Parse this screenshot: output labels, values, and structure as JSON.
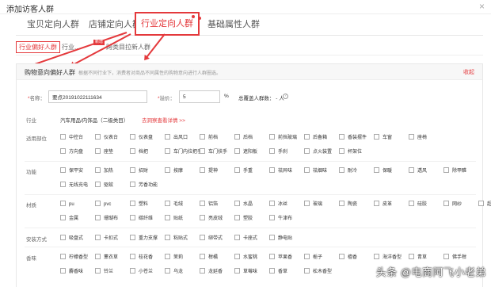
{
  "dialog": {
    "title": "添加访客人群"
  },
  "tabs": [
    {
      "label": "宝贝定向人群"
    },
    {
      "label": "店铺定向人群"
    },
    {
      "label": "行业定向人群"
    },
    {
      "label": "基础属性人群"
    }
  ],
  "subtabs": [
    {
      "label": "行业偏好人群"
    },
    {
      "label": "行业..."
    },
    {
      "label": "跨类目拉新人群"
    }
  ],
  "panel": {
    "title": "购物意向偏好人群",
    "hint": "根据不同行业下，消费者对商品不同属性的购物意向进行人群圈选。",
    "collapse": "收起"
  },
  "form": {
    "name_label": "名称：",
    "name_value": "要点20191022111634",
    "markup_label": "溢价：",
    "markup_value": "5",
    "markup_unit": "%",
    "audience_label": "总覆盖人群数： - 人",
    "industry_label": "行业",
    "industry_value": "汽车用品/内饰品（二级类目）",
    "industry_link": "去洞察查看详情 >>"
  },
  "groups": [
    {
      "label": "适用部位",
      "rows": [
        [
          "中控台",
          "仪表台",
          "仪表盘",
          "出风口",
          "前档",
          "后档",
          "前挡玻璃",
          "后备箱",
          "香装摆件",
          "车窗",
          "座椅"
        ],
        [
          "方向盘",
          "座垫",
          "档把",
          "车门内拉把手",
          "车门扶手",
          "遮阳板",
          "手刹",
          "点火装置",
          "杯架位"
        ]
      ]
    },
    {
      "label": "功能",
      "rows": [
        [
          "保平安",
          "加热",
          "招财",
          "按摩",
          "提神",
          "手重",
          "祛异味",
          "祛烟味",
          "耐冷",
          "保暖",
          "透风",
          "除甲醛"
        ],
        [
          "无线充电",
          "驱蚊",
          "芳香功能"
        ]
      ]
    },
    {
      "label": "材质",
      "rows": [
        [
          "pu",
          "pvc",
          "塑料",
          "毛绒",
          "铝箔",
          "水晶",
          "冰丝",
          "玻璃",
          "陶瓷",
          "皮革",
          "硅胶",
          "网纱",
          "超纤皮"
        ],
        [
          "金属",
          "珊瑚布",
          "碳纤维",
          "贴纸",
          "亮皮绒",
          "塑胶",
          "牛津布"
        ]
      ]
    },
    {
      "label": "安装方式",
      "rows": [
        [
          "吸盘式",
          "卡扣式",
          "重力支撑",
          "粘贴式",
          "绑带式",
          "卡座式",
          "静电贴"
        ]
      ]
    },
    {
      "label": "香味",
      "rows": [
        [
          "柠檬香型",
          "薰衣草",
          "桂花香",
          "茉莉",
          "柑橘",
          "水蜜桃",
          "苹果香",
          "栀子",
          "檀香",
          "海洋香型",
          "青草",
          "佛手柑"
        ],
        [
          "麝香味",
          "铃兰",
          "小苍兰",
          "乌龙",
          "龙延香",
          "草莓味",
          "香草",
          "松木香型"
        ]
      ]
    }
  ],
  "annotations": {
    "new_tag": "新增"
  },
  "watermark": "头条 @电商阿飞小老弟"
}
